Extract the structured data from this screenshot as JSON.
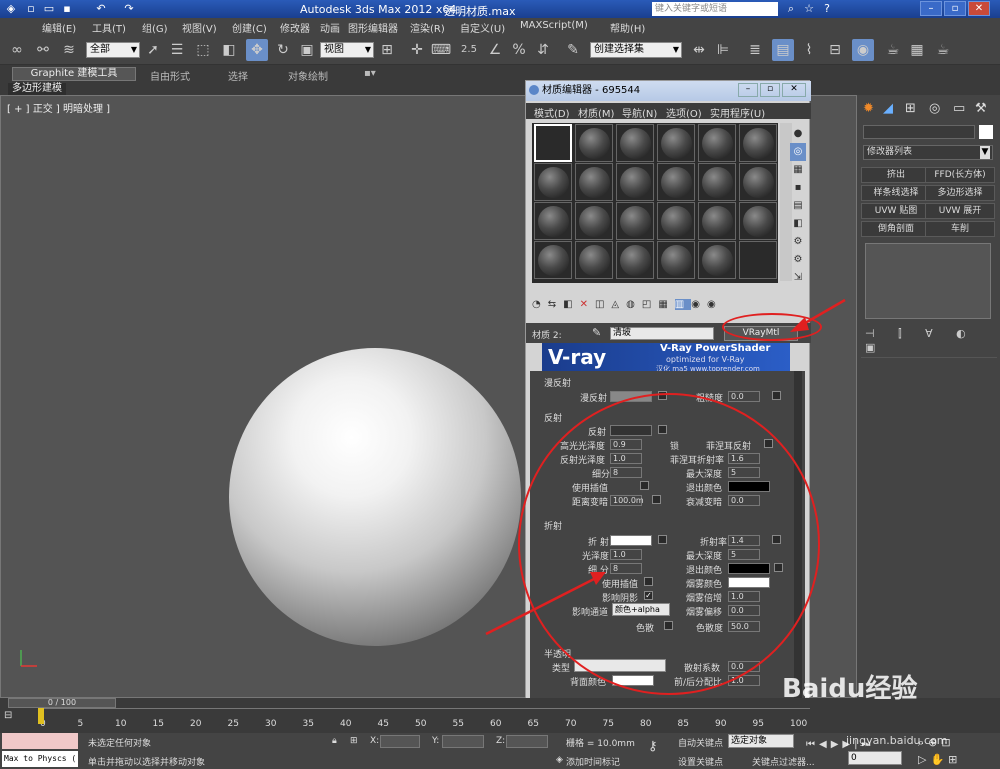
{
  "titlebar": {
    "app": "Autodesk 3ds Max  2012 x64",
    "file": "透明材质.max",
    "search_placeholder": "键入关键字或短语"
  },
  "menubar": [
    "编辑(E)",
    "工具(T)",
    "组(G)",
    "视图(V)",
    "创建(C)",
    "修改器",
    "动画",
    "图形编辑器",
    "渲染(R)",
    "自定义(U)",
    "MAXScript(M)",
    "帮助(H)"
  ],
  "toolbar": {
    "selection_filter": "全部",
    "view_ref": "视图",
    "named_set": "创建选择集",
    "num": "2.5"
  },
  "ribbon": {
    "active": "Graphite 建模工具",
    "tabs": [
      "自由形式",
      "选择",
      "对象绘制"
    ],
    "subtab": "多边形建模"
  },
  "viewport": {
    "label": "[ + ] 正交 ] 明暗处理 ]"
  },
  "command_panel": {
    "modifier_list": "修改器列表",
    "buttons": [
      "挤出",
      "FFD(长方体)",
      "样条线选择",
      "多边形选择",
      "UVW 贴图",
      "UVW 展开",
      "倒角剖面",
      "车削"
    ]
  },
  "material_editor": {
    "title": "材质编辑器 - 695544",
    "menu": [
      "模式(D)",
      "材质(M)",
      "导航(N)",
      "选项(O)",
      "实用程序(U)"
    ],
    "material_label": "材质 2:",
    "material_name": "清玻",
    "material_type": "VRayMtl",
    "banner": {
      "title": "V-Ray PowerShader",
      "sub": "optimized for V-Ray",
      "credit": "汉化 ma5 www.toprender.com",
      "logo": "V-ray"
    },
    "diffuse": {
      "group": "漫反射",
      "label": "漫反射",
      "rough_label": "粗糙度",
      "rough": "0.0"
    },
    "reflect": {
      "group": "反射",
      "reflect": "反射",
      "hilight": "高光光泽度",
      "hilight_val": "0.9",
      "refl_gloss": "反射光泽度",
      "refl_gloss_val": "1.0",
      "subdiv": "细分",
      "subdiv_val": "8",
      "interp": "使用插值",
      "dim": "距离变暗",
      "dim_val": "100.0m",
      "lock": "锁",
      "fresnel": "菲涅耳反射",
      "fresnel_ior": "菲涅耳折射率",
      "fresnel_ior_val": "1.6",
      "maxdepth": "最大深度",
      "maxdepth_val": "5",
      "exitcolor": "退出颜色",
      "falloff": "衰减变暗",
      "falloff_val": "0.0"
    },
    "refract": {
      "group": "折射",
      "refract": "折 射",
      "gloss": "光泽度",
      "gloss_val": "1.0",
      "subdiv": "细 分",
      "subdiv_val": "8",
      "interp": "使用插值",
      "shadow": "影响阴影",
      "channel": "影响通道",
      "channel_val": "颜色+alpha",
      "ior": "折射率",
      "ior_val": "1.4",
      "maxdepth": "最大深度",
      "maxdepth_val": "5",
      "exitcolor": "退出颜色",
      "fogcolor": "烟雾颜色",
      "fogmult": "烟雾倍增",
      "fogmult_val": "1.0",
      "fogbias": "烟雾偏移",
      "fogbias_val": "0.0",
      "disp": "色散",
      "abbe": "色散度",
      "abbe_val": "50.0"
    },
    "translucency": {
      "group": "半透明",
      "type": "类型",
      "back": "背面颜色",
      "scatter": "散射系数",
      "scatter_val": "0.0",
      "fb": "前/后分配比",
      "fb_val": "1.0"
    }
  },
  "timeline": {
    "frame": "0 / 100",
    "ticks": [
      "0",
      "5",
      "10",
      "15",
      "20",
      "25",
      "30",
      "35",
      "40",
      "45",
      "50",
      "55",
      "60",
      "65",
      "70",
      "75",
      "80",
      "85",
      "90",
      "95",
      "100"
    ]
  },
  "status": {
    "script": "Max to Physcs (",
    "msg1": "未选定任何对象",
    "msg2": "单击并拖动以选择并移动对象",
    "x": "X:",
    "y": "Y:",
    "z": "Z:",
    "grid": "栅格 = 10.0mm",
    "add_tag": "添加时间标记",
    "autokey": "自动关键点",
    "setkey": "设置关键点",
    "sel_obj": "选定对象",
    "key_filter": "关键点过滤器...",
    "frame": "0"
  },
  "watermark": {
    "text": "Baidu经验",
    "url": "jingyan.baidu.com"
  }
}
